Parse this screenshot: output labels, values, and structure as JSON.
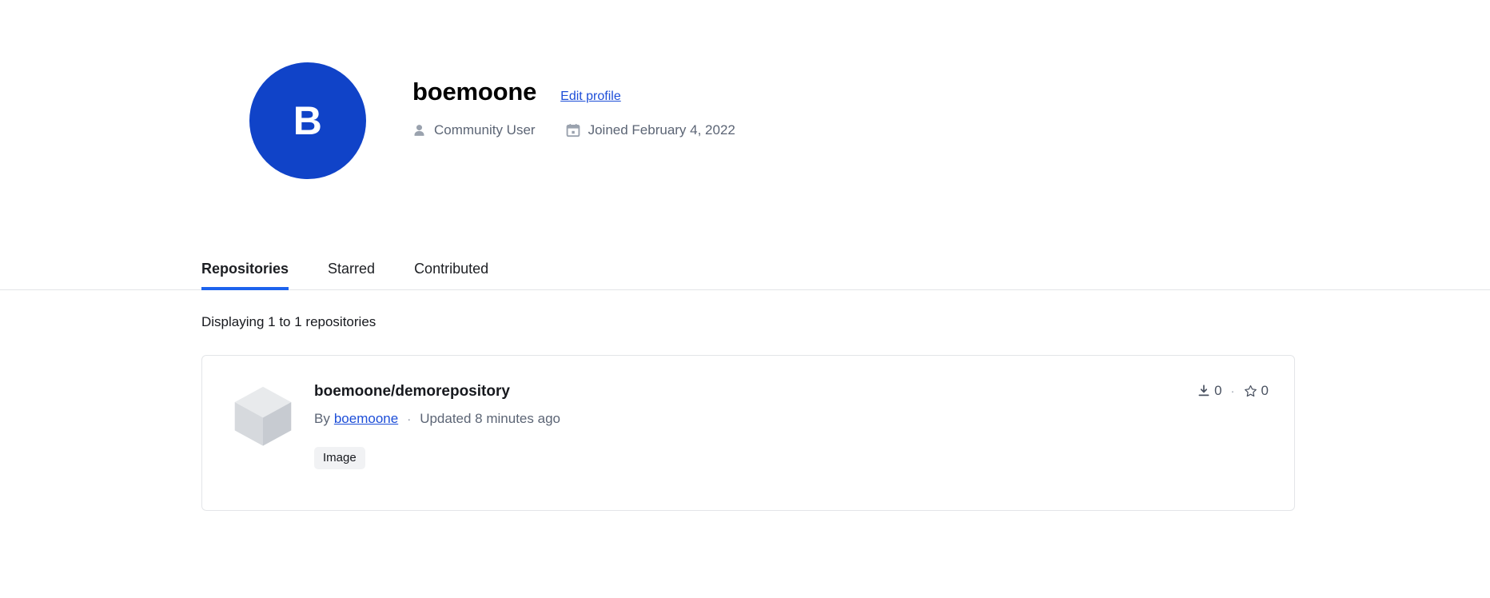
{
  "profile": {
    "avatar_initial": "B",
    "avatar_color": "#1043c8",
    "username": "boemoone",
    "edit_profile_label": "Edit profile",
    "meta": [
      {
        "icon": "user-icon",
        "label": "Community User"
      },
      {
        "icon": "calendar-icon",
        "label": "Joined February 4, 2022"
      }
    ]
  },
  "tabs": [
    {
      "label": "Repositories",
      "active": true
    },
    {
      "label": "Starred",
      "active": false
    },
    {
      "label": "Contributed",
      "active": false
    }
  ],
  "results": {
    "count_text": "Displaying 1 to 1 repositories"
  },
  "repositories": [
    {
      "thumbnail": "cube-icon",
      "title": "boemoone/demorepository",
      "by_label": "By",
      "author": "boemoone",
      "separator": "·",
      "updated": "Updated 8 minutes ago",
      "badges": [
        "Image"
      ],
      "stats": {
        "downloads_icon": "download-icon",
        "downloads": "0",
        "separator": "·",
        "stars_icon": "star-icon",
        "stars": "0"
      }
    }
  ],
  "colors": {
    "accent_blue": "#1d63ed",
    "link_blue": "#1d4ed8",
    "border": "#e3e5e8",
    "muted_text": "#5c6575"
  }
}
